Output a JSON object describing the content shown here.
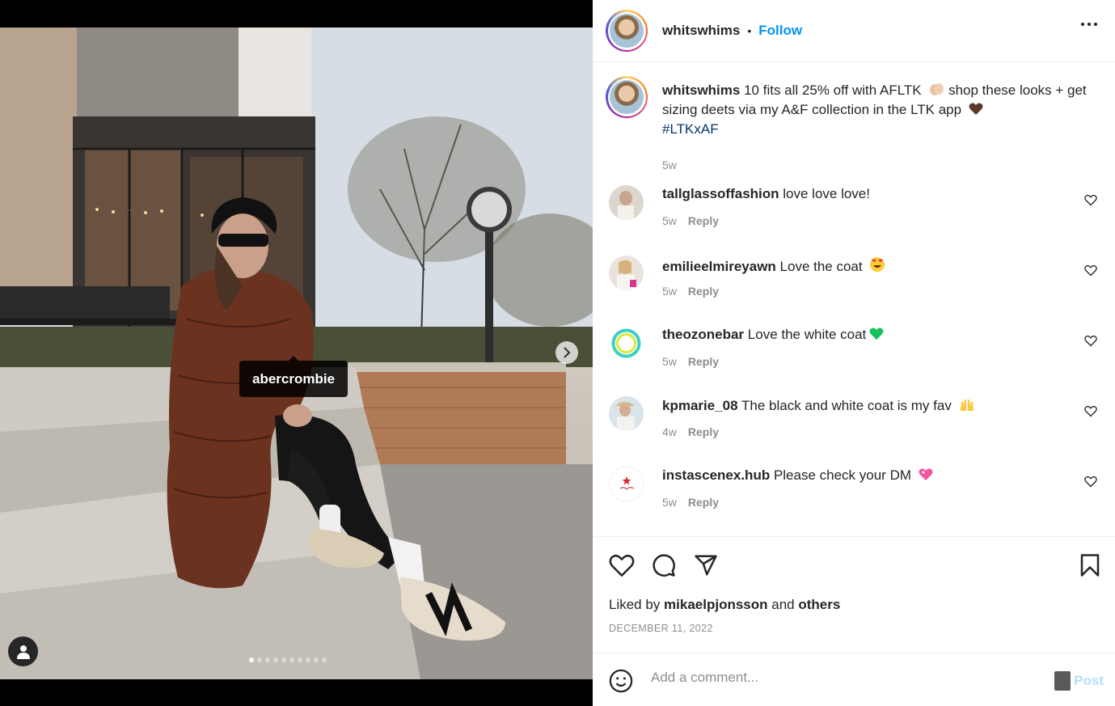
{
  "post": {
    "image_tag_label": "abercrombie",
    "carousel": {
      "total": 10,
      "active_index": 0
    }
  },
  "header": {
    "username": "whitswhims",
    "separator": "•",
    "follow_label": "Follow"
  },
  "caption": {
    "username": "whitswhims",
    "text_part1": " 10 fits all 25% off with AFLTK ",
    "text_part2": " shop these looks + get sizing deets via my A&F collection in the LTK app ",
    "hashtag": "#LTKxAF",
    "time": "5w"
  },
  "comments": [
    {
      "username": "tallglassoffashion",
      "text": " love love love!",
      "time": "5w",
      "reply_label": "Reply",
      "emoji": ""
    },
    {
      "username": "emilieelmireyawn",
      "text": " Love the coat ",
      "time": "5w",
      "reply_label": "Reply",
      "emoji": "heart-eyes"
    },
    {
      "username": "theozonebar",
      "text": " Love the white coat",
      "time": "5w",
      "reply_label": "Reply",
      "emoji": "green-heart"
    },
    {
      "username": "kpmarie_08",
      "text": " The black and white coat is my fav ",
      "time": "4w",
      "reply_label": "Reply",
      "emoji": "raised-hands"
    },
    {
      "username": "instascenex.hub",
      "text": " Please check your DM ",
      "time": "5w",
      "reply_label": "Reply",
      "emoji": "sparkling-heart"
    }
  ],
  "likes": {
    "prefix": "Liked by ",
    "user": "mikaelpjonsson",
    "middle": " and ",
    "others": "others"
  },
  "date": "DECEMBER 11, 2022",
  "add_comment": {
    "placeholder": "Add a comment...",
    "post_label": "Post"
  },
  "colors": {
    "accent": "#0095f6",
    "hashtag": "#00376b",
    "muted": "#8e8e8e",
    "text": "#262626",
    "post_disabled": "#b2dffc"
  }
}
